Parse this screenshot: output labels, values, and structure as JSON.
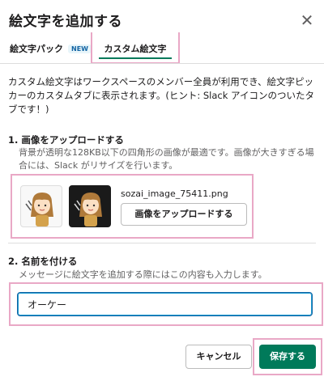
{
  "dialog": {
    "title": "絵文字を追加する",
    "close_icon": "close-icon"
  },
  "tabs": {
    "pack_label": "絵文字パック",
    "pack_badge": "NEW",
    "custom_label": "カスタム絵文字"
  },
  "description": "カスタム絵文字はワークスペースのメンバー全員が利用でき、絵文字ピッカーのカスタムタブに表示されます。(ヒント: Slack アイコンのついたタブです！)",
  "upload_section": {
    "title": "1. 画像をアップロードする",
    "hint": "背景が透明な128KB以下の四角形の画像が最適です。画像が大きすぎる場合には、Slack がリサイズを行います。",
    "filename": "sozai_image_75411.png",
    "button_label": "画像をアップロードする"
  },
  "name_section": {
    "title": "2. 名前を付ける",
    "hint": "メッセージに絵文字を追加する際にはこの内容も入力します。",
    "input_value": "オーケー"
  },
  "footer": {
    "cancel_label": "キャンセル",
    "save_label": "保存する"
  },
  "colors": {
    "accent": "#007a5a",
    "highlight_border": "#e9a8c6",
    "link_blue": "#1264a3"
  }
}
